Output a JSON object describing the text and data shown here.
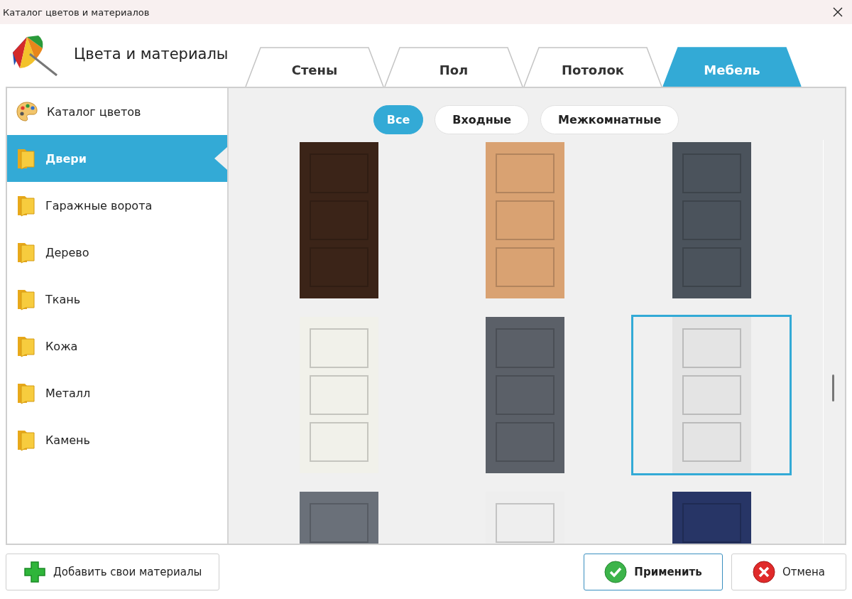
{
  "window": {
    "title": "Каталог цветов и материалов"
  },
  "header": {
    "title": "Цвета и материалы"
  },
  "tabs": [
    {
      "label": "Стены",
      "selected": false
    },
    {
      "label": "Пол",
      "selected": false
    },
    {
      "label": "Потолок",
      "selected": false
    },
    {
      "label": "Мебель",
      "selected": true
    }
  ],
  "sidebar": {
    "items": [
      {
        "label": "Каталог цветов",
        "kind": "palette",
        "selected": false
      },
      {
        "label": "Двери",
        "kind": "folder",
        "selected": true
      },
      {
        "label": "Гаражные ворота",
        "kind": "folder",
        "selected": false
      },
      {
        "label": "Дерево",
        "kind": "folder",
        "selected": false
      },
      {
        "label": "Ткань",
        "kind": "folder",
        "selected": false
      },
      {
        "label": "Кожа",
        "kind": "folder",
        "selected": false
      },
      {
        "label": "Металл",
        "kind": "folder",
        "selected": false
      },
      {
        "label": "Камень",
        "kind": "folder",
        "selected": false
      }
    ]
  },
  "filters": [
    {
      "label": "Все",
      "selected": true
    },
    {
      "label": "Входные",
      "selected": false
    },
    {
      "label": "Межкомнатные",
      "selected": false
    }
  ],
  "swatches": [
    {
      "color": "#3b2418",
      "selected": false
    },
    {
      "color": "#d9a272",
      "selected": false
    },
    {
      "color": "#4b535c",
      "selected": false
    },
    {
      "color": "#f1f1ea",
      "selected": false
    },
    {
      "color": "#5b6068",
      "selected": false
    },
    {
      "color": "#e4e4e4",
      "selected": true
    },
    {
      "color": "#6a7079",
      "selected": false
    },
    {
      "color": "#eeeeee",
      "selected": false
    },
    {
      "color": "#273566",
      "selected": false
    }
  ],
  "buttons": {
    "add": "Добавить свои материалы",
    "apply": "Применить",
    "cancel": "Отмена"
  }
}
